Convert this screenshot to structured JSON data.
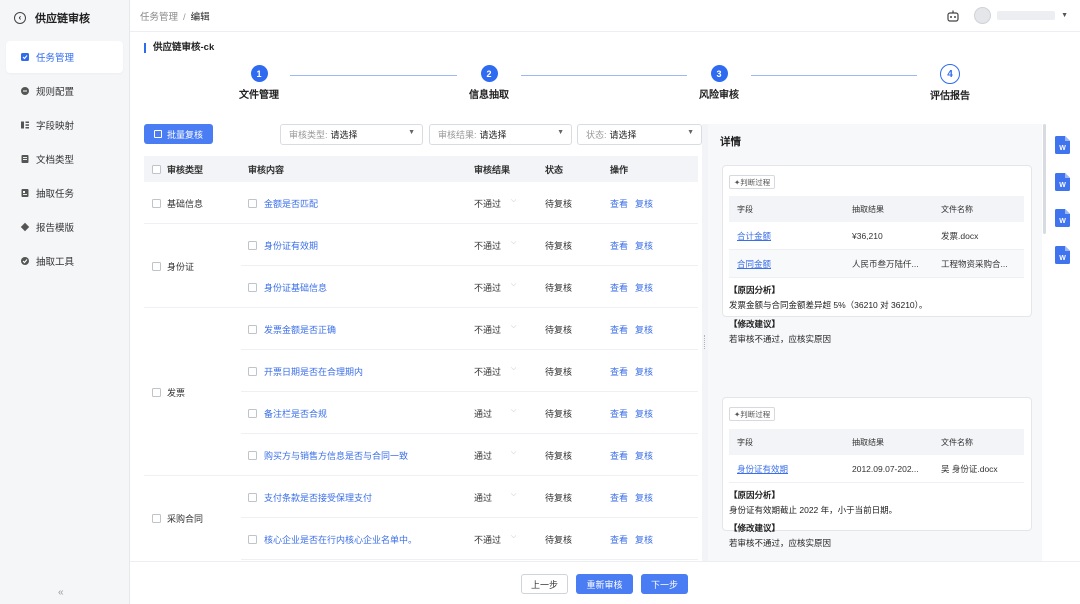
{
  "app": {
    "title": "供应链审核"
  },
  "sidebar": {
    "items": [
      {
        "label": "任务管理",
        "icon": "task-icon",
        "active": true
      },
      {
        "label": "规则配置",
        "icon": "rule-icon",
        "active": false
      },
      {
        "label": "字段映射",
        "icon": "field-map-icon",
        "active": false
      },
      {
        "label": "文档类型",
        "icon": "doc-type-icon",
        "active": false
      },
      {
        "label": "抽取任务",
        "icon": "extract-task-icon",
        "active": false
      },
      {
        "label": "报告模版",
        "icon": "report-template-icon",
        "active": false
      },
      {
        "label": "抽取工具",
        "icon": "extract-tool-icon",
        "active": false
      }
    ],
    "collapse": "«"
  },
  "breadcrumb": {
    "parent": "任务管理",
    "sep": "/",
    "current": "编辑"
  },
  "page": {
    "title": "供应链审核-ck"
  },
  "steps": [
    {
      "num": "1",
      "label": "文件管理"
    },
    {
      "num": "2",
      "label": "信息抽取"
    },
    {
      "num": "3",
      "label": "风险审核"
    },
    {
      "num": "4",
      "label": "评估报告"
    }
  ],
  "toolbar": {
    "batch_label": "批量复核"
  },
  "filters": [
    {
      "prefix": "审核类型:",
      "value": "请选择"
    },
    {
      "prefix": "审核结果:",
      "value": "请选择"
    },
    {
      "prefix": "状态:",
      "value": "请选择"
    }
  ],
  "table": {
    "headers": {
      "type": "审核类型",
      "content": "审核内容",
      "result": "审核结果",
      "status": "状态",
      "op": "操作"
    },
    "categories": [
      {
        "label": "基础信息"
      },
      {
        "label": "身份证"
      },
      {
        "label": "发票"
      },
      {
        "label": "采购合同"
      }
    ],
    "rows": [
      {
        "content": "金额是否匹配",
        "result": "不通过",
        "status": "待复核"
      },
      {
        "content": "身份证有效期",
        "result": "不通过",
        "status": "待复核"
      },
      {
        "content": "身份证基础信息",
        "result": "不通过",
        "status": "待复核"
      },
      {
        "content": "发票金额是否正确",
        "result": "不通过",
        "status": "待复核"
      },
      {
        "content": "开票日期是否在合理期内",
        "result": "不通过",
        "status": "待复核"
      },
      {
        "content": "备注栏是否合规",
        "result": "通过",
        "status": "待复核"
      },
      {
        "content": "购买方与销售方信息是否与合同一致",
        "result": "通过",
        "status": "待复核"
      },
      {
        "content": "支付条款是否接受保理支付",
        "result": "通过",
        "status": "待复核"
      },
      {
        "content": "核心企业是否在行内核心企业名单中。",
        "result": "不通过",
        "status": "待复核"
      }
    ],
    "op_view": "查看",
    "op_review": "复核"
  },
  "detail": {
    "title": "详情",
    "tag_label": "判断过程",
    "sub_headers": {
      "field": "字段",
      "value": "抽取结果",
      "file": "文件名称"
    },
    "cards": [
      {
        "rows": [
          {
            "field": "合计金额",
            "value": "¥36,210",
            "file": "发票.docx"
          },
          {
            "field": "合同金额",
            "value": "人民币叁万陆仟...",
            "file": "工程物资采购合..."
          }
        ],
        "reason_title": "【原因分析】",
        "reason_text": "发票金额与合同金额差异超 5%（36210 对 36210）。",
        "advice_title": "【修改建议】",
        "advice_text": "若审核不通过，应核实原因"
      },
      {
        "rows": [
          {
            "field": "身份证有效期",
            "value": "2012.09.07-202...",
            "file": "吴   身份证.docx"
          }
        ],
        "reason_title": "【原因分析】",
        "reason_text": "身份证有效期截止 2022 年，小于当前日期。",
        "advice_title": "【修改建议】",
        "advice_text": "若审核不通过，应核实原因"
      }
    ]
  },
  "footer": {
    "prev": "上一步",
    "recheck": "重新审核",
    "next": "下一步"
  },
  "colors": {
    "accent": "#2f6bf0",
    "link": "#3b6fe8",
    "file_icon": "#3f74ee"
  }
}
